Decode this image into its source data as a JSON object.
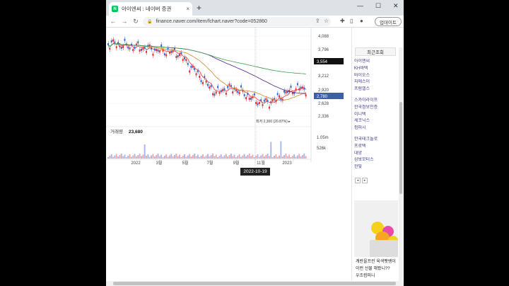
{
  "browser": {
    "tab_title": "아이엔씨 : 네이버 증권",
    "tab_close": "×",
    "new_tab": "+",
    "win_minimize": "—",
    "win_maximize": "☐",
    "win_close": "✕",
    "back": "←",
    "forward": "→",
    "reload": "↻",
    "url": "finance.naver.com/item/fchart.naver?code=052860",
    "update_button": "업데이트"
  },
  "chart": {
    "price_ticks": [
      "4,088",
      "3,796",
      "3,212",
      "2,920",
      "2,628",
      "2,336"
    ],
    "current_price": "3,554",
    "last_price": "2,780",
    "min_annotation": "최저 2,300 (20.87%) ▸",
    "volume_label": "거래량",
    "volume_value": "23,680",
    "volume_ticks": [
      "1.05m",
      "526k"
    ],
    "x_ticks": [
      "2022",
      "3월",
      "5월",
      "7월",
      "9월",
      "11월",
      "2023"
    ],
    "cursor_date": "2022-10-19",
    "colors": {
      "up": "#e62b2b",
      "down": "#2b67d6",
      "ma5": "#e04040",
      "ma20": "#d08a2a",
      "ma60": "#4a2090",
      "ma120": "#3aa04a",
      "last_tag": "#3e5fa8"
    }
  },
  "sidebar": {
    "header": "최근조회",
    "group1": [
      "아이엔씨",
      "KH바텍",
      "바이오스",
      "지에스이",
      "프럼엘스"
    ],
    "group2": [
      "스카이라이프",
      "한국정보인증",
      "이니텍",
      "세코닉스",
      "컴퍼시"
    ],
    "group3": [
      "한국테크놀로",
      "프로텍",
      "대양",
      "삼보모터스",
      "한빛"
    ],
    "pager_prev": "◂",
    "pager_next": "▸",
    "ad_line1": "계란을프린 육색팻뱅이",
    "ad_line2": "이런 선물 해봤니??",
    "ad_line3": "우조컴퍼니"
  }
}
